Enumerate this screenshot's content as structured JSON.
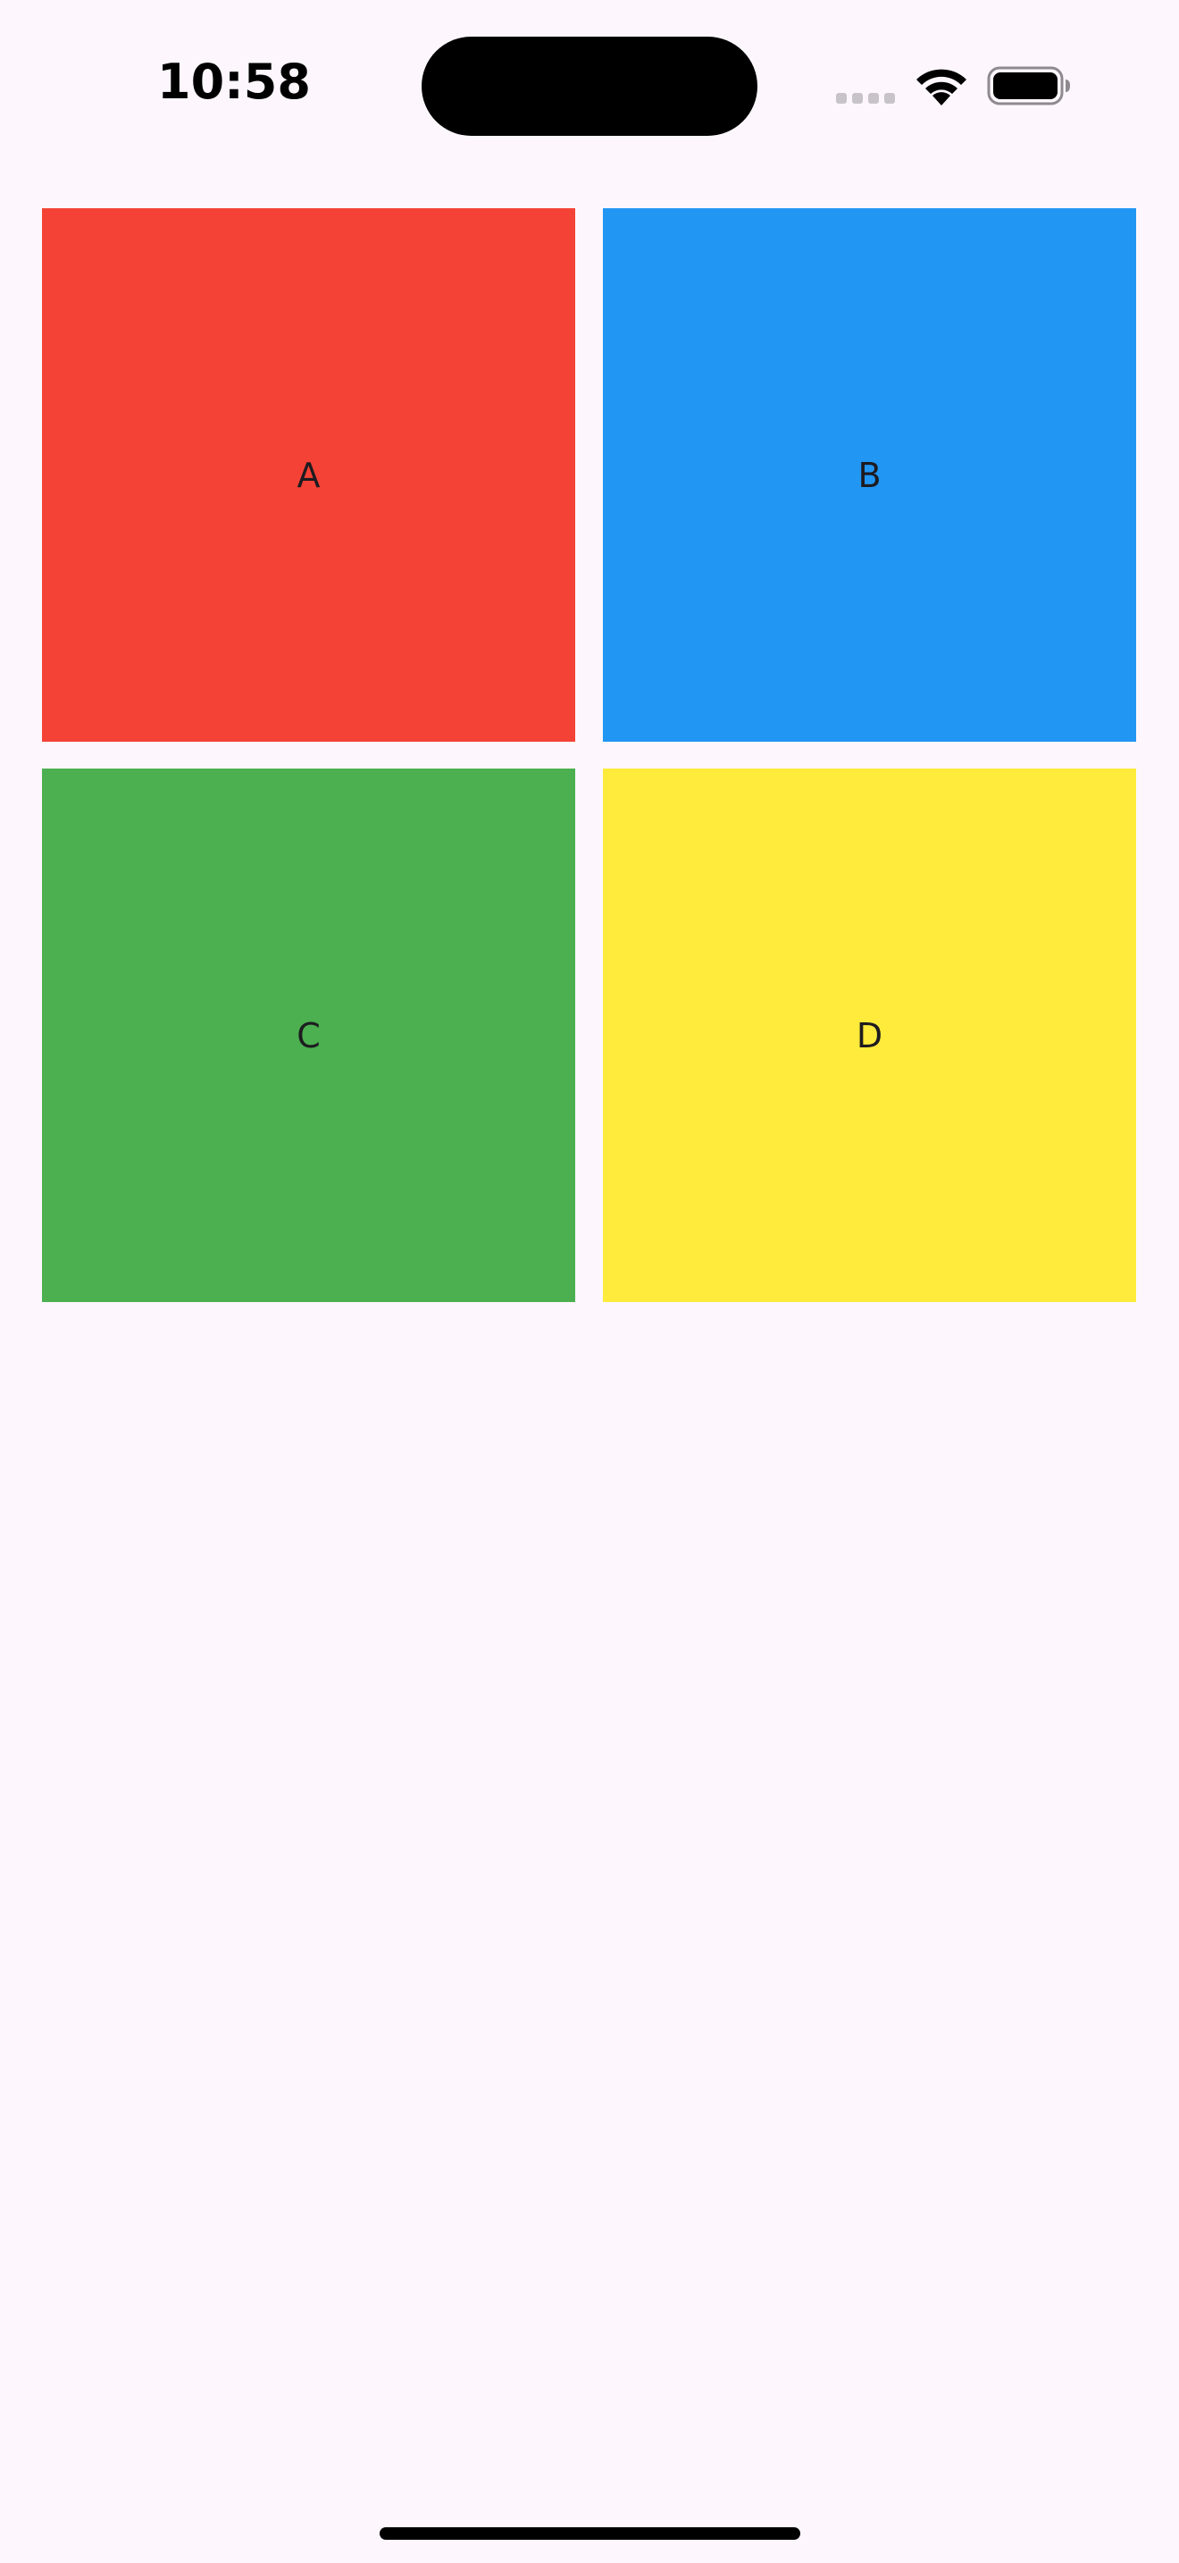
{
  "status_bar": {
    "time": "10:58",
    "icons": {
      "signal": "cellular-signal-icon",
      "wifi": "wifi-icon",
      "battery": "battery-icon"
    }
  },
  "grid": {
    "tiles": [
      {
        "label": "A",
        "color": "#f44336"
      },
      {
        "label": "B",
        "color": "#2196f3"
      },
      {
        "label": "C",
        "color": "#4caf50"
      },
      {
        "label": "D",
        "color": "#ffeb3b"
      }
    ]
  },
  "colors": {
    "background": "#fdf7fd",
    "label_text": "#1d1b20"
  }
}
